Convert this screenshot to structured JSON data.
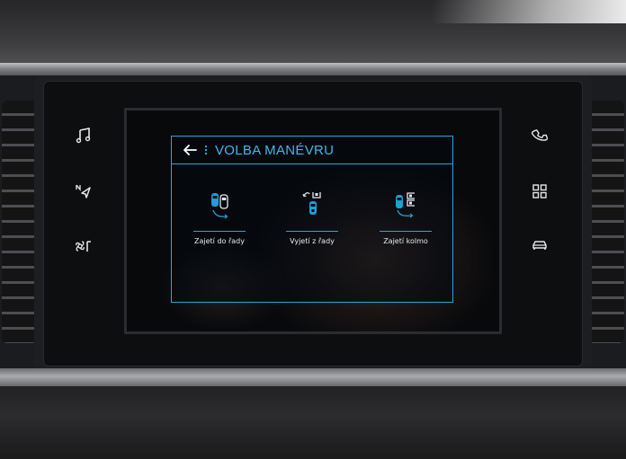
{
  "screen": {
    "header": {
      "back_icon": "back-arrow-icon",
      "title": "VOLBA MANÉVRU"
    },
    "options": [
      {
        "icon": "parallel-park-in-icon",
        "label": "Zajetí do řady"
      },
      {
        "icon": "parallel-park-out-icon",
        "label": "Vyjetí z řady"
      },
      {
        "icon": "perpendicular-park-icon",
        "label": "Zajetí kolmo"
      }
    ]
  },
  "left_buttons": [
    "music-note-icon",
    "navigation-icon",
    "fan-climate-icon"
  ],
  "right_buttons": [
    "phone-icon",
    "apps-grid-icon",
    "car-icon"
  ],
  "colors": {
    "accent": "#29a7d8",
    "title": "#3fb8e8",
    "icon_blue": "#1e9fd6",
    "text": "#e6eaee"
  }
}
